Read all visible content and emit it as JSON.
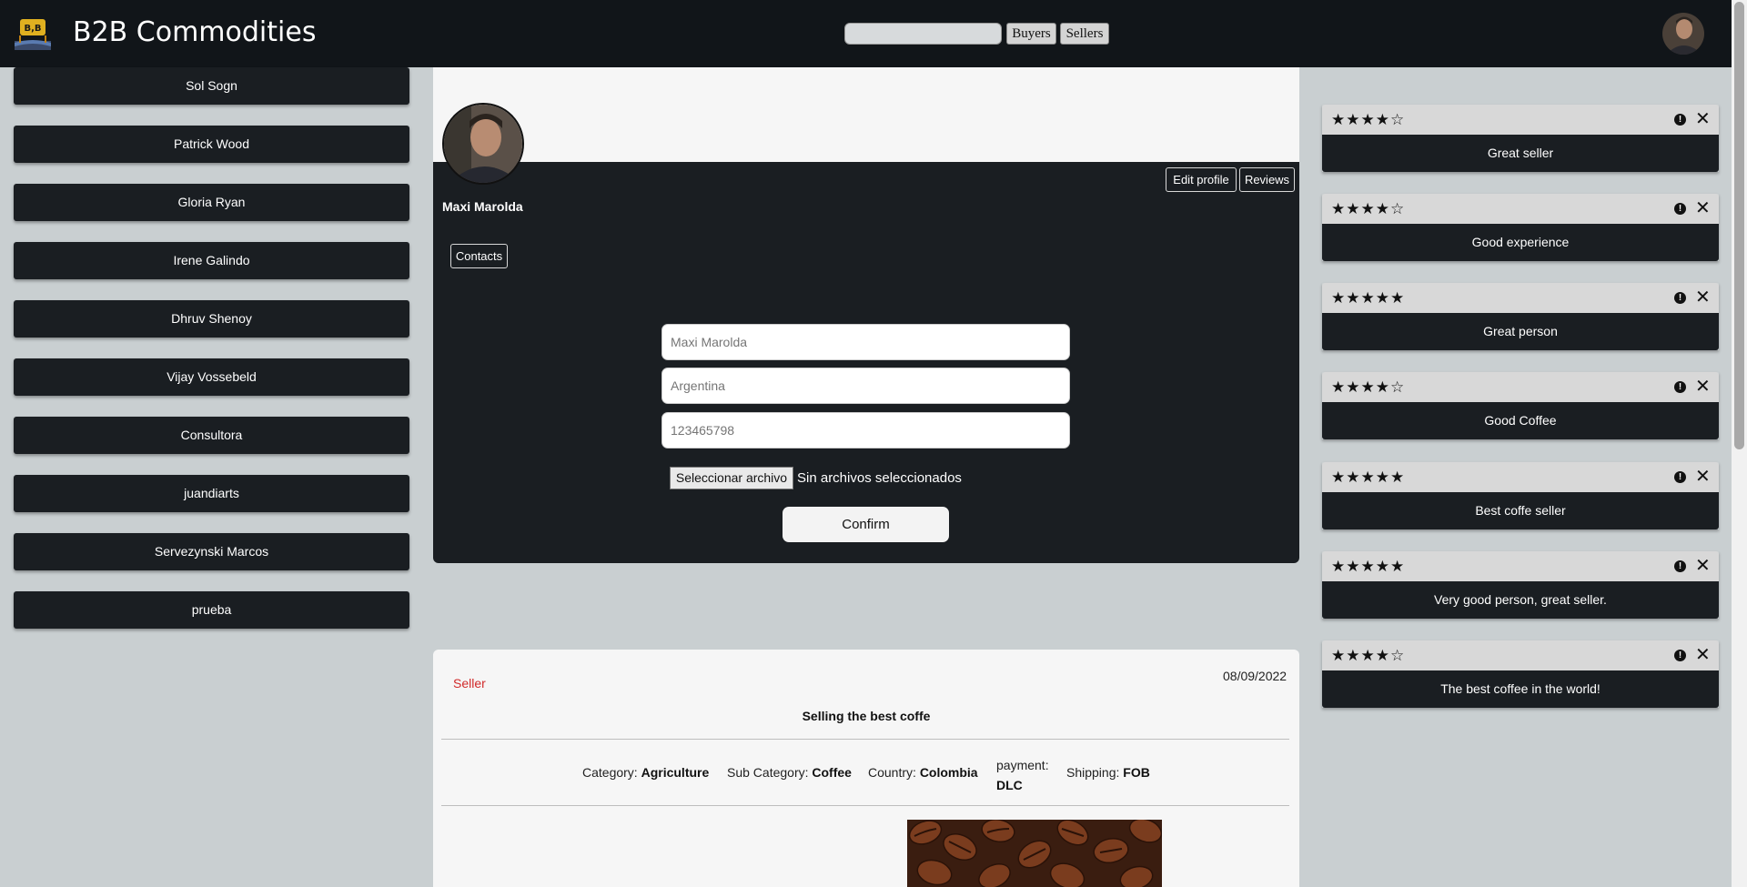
{
  "header": {
    "brand": "B2B Commodities",
    "logo_text": "B,B",
    "search": {
      "value": "",
      "placeholder": ""
    },
    "buyers_label": "Buyers",
    "sellers_label": "Sellers"
  },
  "sidebar": {
    "users": [
      "Sol Sogn",
      "Patrick Wood",
      "Gloria Ryan",
      "Irene Galindo",
      "Dhruv Shenoy",
      "Vijay Vossebeld",
      "Consultora",
      "juandiarts",
      "Servezynski Marcos",
      "prueba"
    ]
  },
  "profile": {
    "name": "Maxi Marolda",
    "edit_label": "Edit profile",
    "reviews_label": "Reviews",
    "contacts_label": "Contacts",
    "form": {
      "name_placeholder": "Maxi Marolda",
      "country_placeholder": "Argentina",
      "phone_placeholder": "123465798",
      "file_button": "Seleccionar archivo",
      "file_status": "Sin archivos seleccionados",
      "confirm_label": "Confirm"
    }
  },
  "post": {
    "role": "Seller",
    "date": "08/09/2022",
    "title": "Selling the best coffe",
    "category_label": "Category:",
    "category": "Agriculture",
    "subcategory_label": "Sub Category:",
    "subcategory": "Coffee",
    "country_label": "Country:",
    "country": "Colombia",
    "payment_label": "payment:",
    "payment": "DLC",
    "shipping_label": "Shipping:",
    "shipping": "FOB",
    "role_color": "#d12a2a"
  },
  "reviews": [
    {
      "rating": 4,
      "text": "Great seller"
    },
    {
      "rating": 4,
      "text": "Good experience"
    },
    {
      "rating": 5,
      "text": "Great person"
    },
    {
      "rating": 4,
      "text": "Good Coffee"
    },
    {
      "rating": 5,
      "text": "Best coffe seller"
    },
    {
      "rating": 5,
      "text": "Very good person, great seller."
    },
    {
      "rating": 4,
      "text": "The best coffee in the world!"
    }
  ],
  "colors": {
    "topbar": "#111519",
    "panel": "#1a1e22",
    "background": "#c9cfd1"
  }
}
